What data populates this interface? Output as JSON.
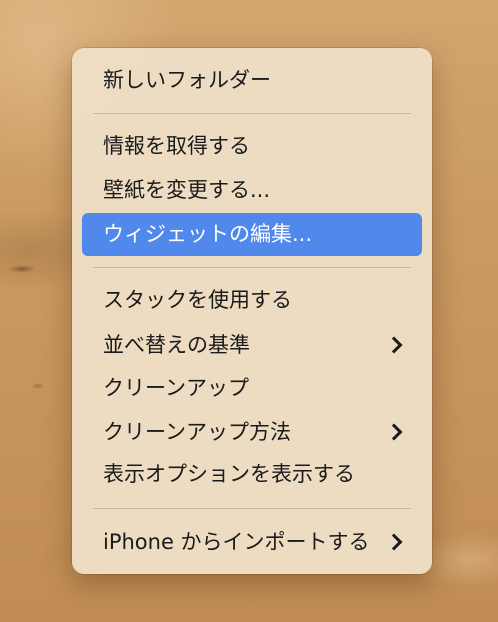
{
  "context_menu": {
    "new_folder": "新しいフォルダー",
    "get_info": "情報を取得する",
    "change_wallpaper": "壁紙を変更する...",
    "edit_widgets": "ウィジェットの編集...",
    "use_stacks": "スタックを使用する",
    "sort_by": "並べ替えの基準",
    "clean_up": "クリーンアップ",
    "clean_up_by": "クリーンアップ方法",
    "show_view_options": "表示オプションを表示する",
    "import_from_iphone": "iPhone からインポートする"
  },
  "colors": {
    "highlight": "#5088ec",
    "menu_background": "#eedec5",
    "text": "#1a1a1a"
  }
}
